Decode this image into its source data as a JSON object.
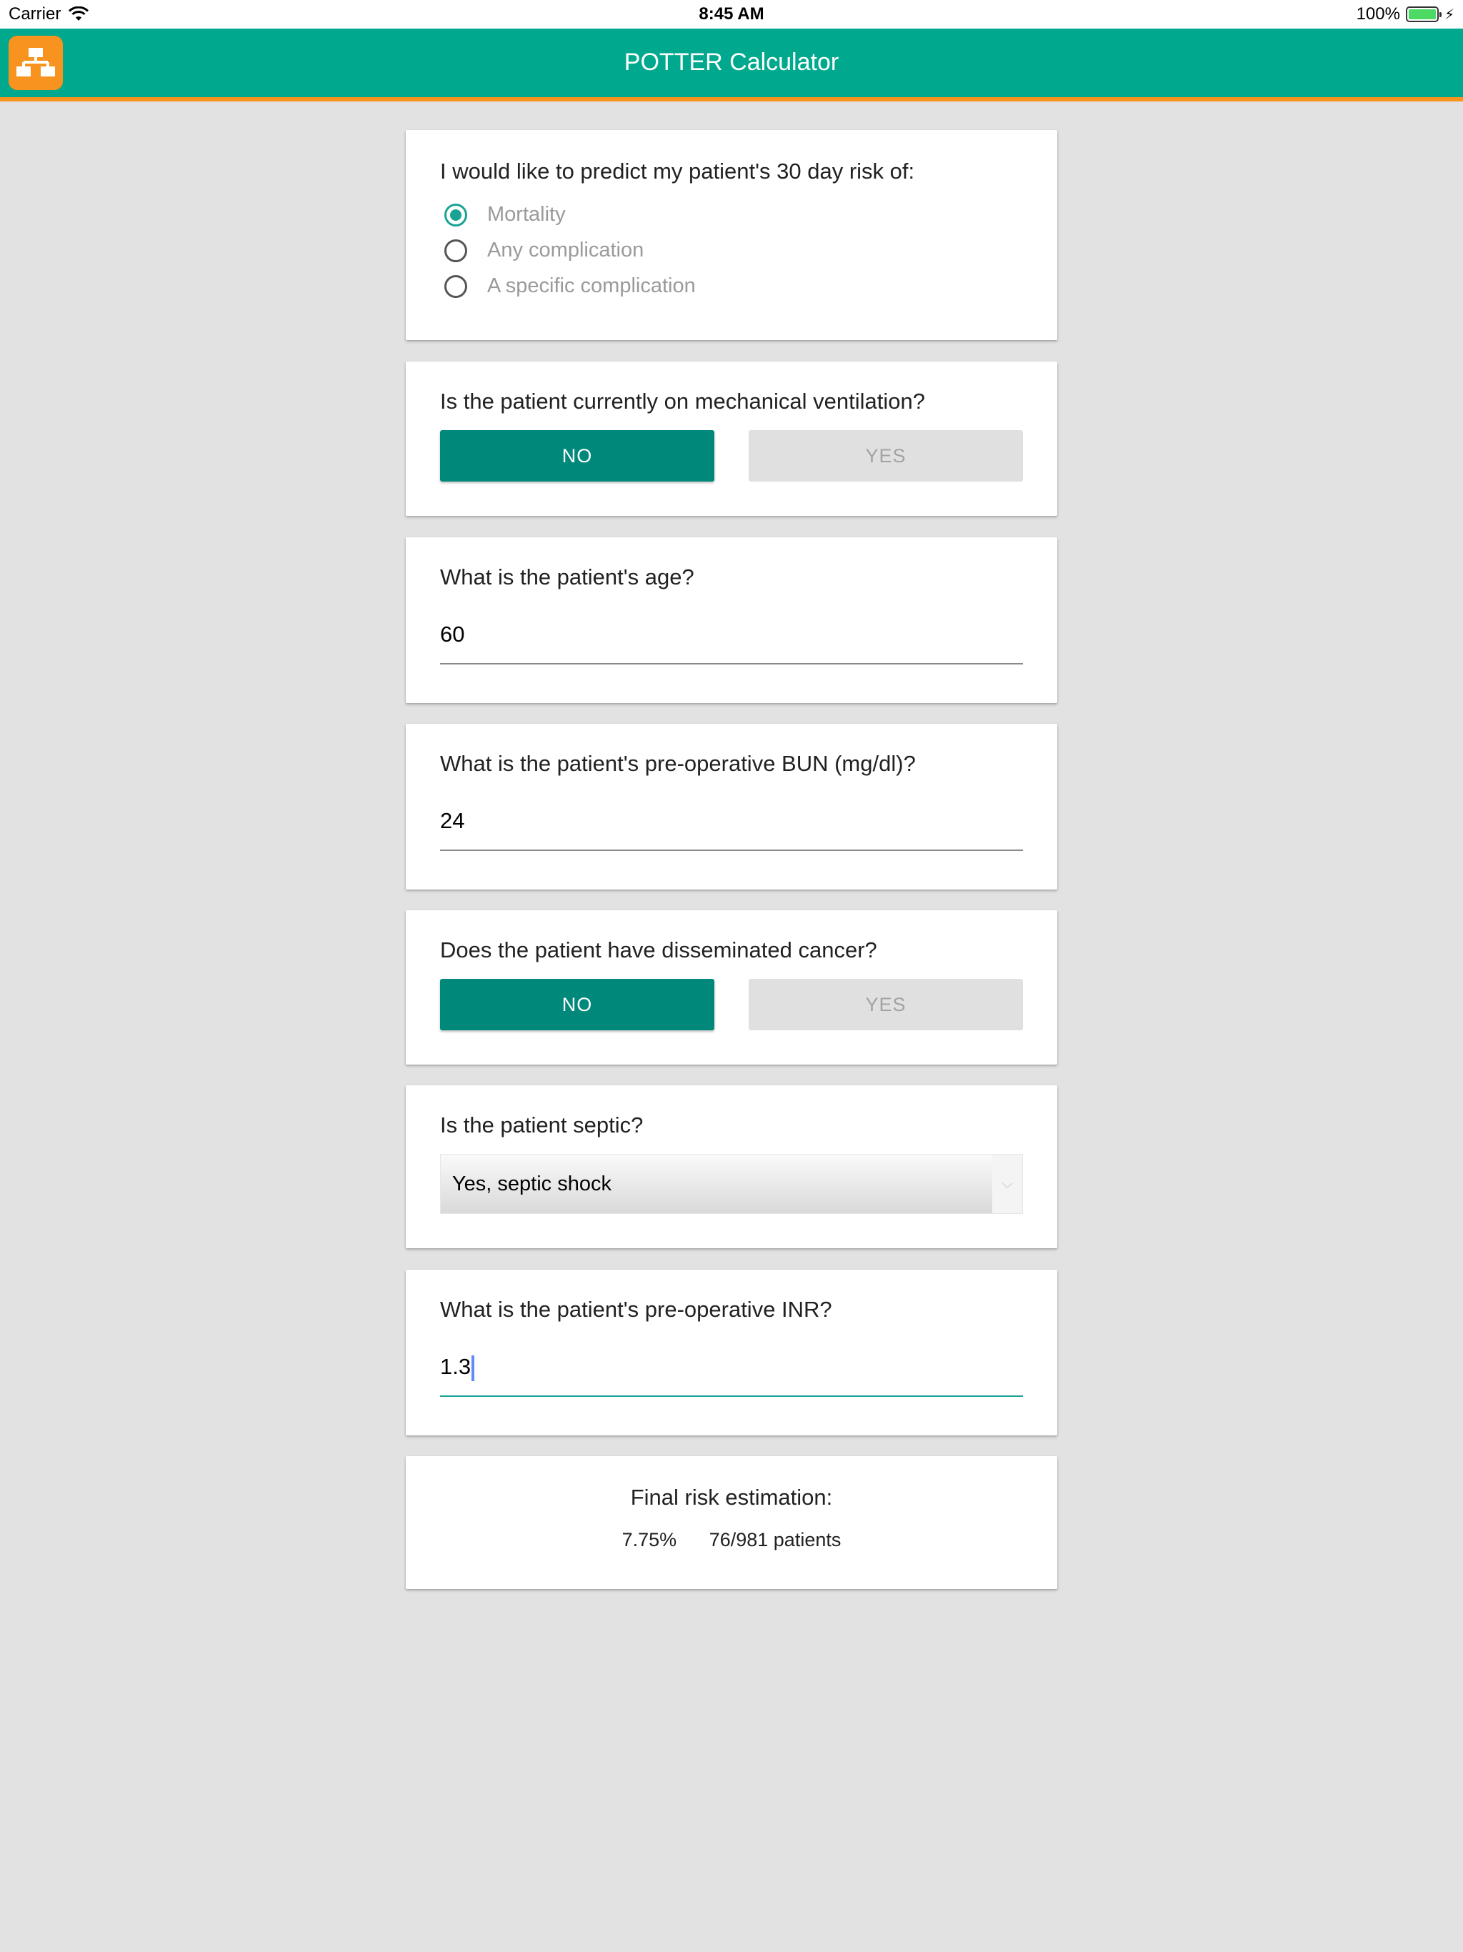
{
  "status_bar": {
    "carrier": "Carrier",
    "time": "8:45 AM",
    "battery": "100%"
  },
  "header": {
    "title": "POTTER Calculator",
    "logo_icon": "flowchart-icon",
    "colors": {
      "bar": "#00a98d",
      "accent": "#f7931e"
    }
  },
  "risk": {
    "question": "I would like to predict my patient's 30 day risk of:",
    "options": [
      "Mortality",
      "Any complication",
      "A specific complication"
    ],
    "selected": "Mortality"
  },
  "ventilation": {
    "question": "Is the patient currently on mechanical ventilation?",
    "no_label": "NO",
    "yes_label": "YES",
    "selected": "NO"
  },
  "age": {
    "question": "What is the patient's age?",
    "value": "60"
  },
  "bun": {
    "question": "What is the patient's pre-operative BUN (mg/dl)?",
    "value": "24"
  },
  "cancer": {
    "question": "Does the patient have disseminated cancer?",
    "no_label": "NO",
    "yes_label": "YES",
    "selected": "NO"
  },
  "septic": {
    "question": "Is the patient septic?",
    "selected_option": "Yes, septic shock"
  },
  "inr": {
    "question": "What is the patient's pre-operative INR?",
    "value": "1.3"
  },
  "result": {
    "title": "Final risk estimation:",
    "percent": "7.75%",
    "patients": "76/981 patients"
  }
}
